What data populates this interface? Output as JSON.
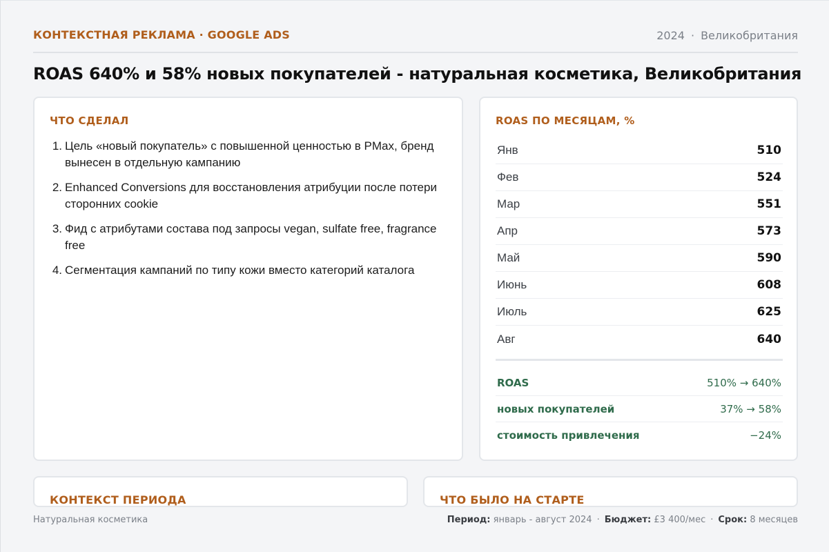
{
  "header": {
    "kicker": "КОНТЕКСТНАЯ РЕКЛАМА · GOOGLE ADS",
    "year": "2024",
    "separator": "·",
    "region": "Великобритания"
  },
  "headline": "ROAS 640% и 58% новых покупателей - натуральная косметика, Великобритания",
  "did": {
    "title": "ЧТО СДЕЛАЛ",
    "items": [
      {
        "num": "1.",
        "text": "Цель «новый покупатель» с повышенной ценностью в PMax, бренд вынесен в отдельную кампанию"
      },
      {
        "num": "2.",
        "text": "Enhanced Conversions для восстановления атрибуции после потери сторонних cookie"
      },
      {
        "num": "3.",
        "text": "Фид с атрибутами состава под запросы vegan, sulfate free, fragrance free"
      },
      {
        "num": "4.",
        "text": "Сегментация кампаний по типу кожи вместо категорий каталога"
      }
    ]
  },
  "roas": {
    "title": "ROAS ПО МЕСЯЦАМ, %",
    "months": [
      {
        "name": "Янв",
        "value": "510"
      },
      {
        "name": "Фев",
        "value": "524"
      },
      {
        "name": "Мар",
        "value": "551"
      },
      {
        "name": "Апр",
        "value": "573"
      },
      {
        "name": "Май",
        "value": "590"
      },
      {
        "name": "Июнь",
        "value": "608"
      },
      {
        "name": "Июль",
        "value": "625"
      },
      {
        "name": "Авг",
        "value": "640"
      }
    ],
    "summary": [
      {
        "label": "ROAS",
        "value": "510% → 640%"
      },
      {
        "label": "новых покупателей",
        "value": "37% → 58%"
      },
      {
        "label": "стоимость привлечения",
        "value": "−24%"
      }
    ]
  },
  "cards": {
    "context_title": "КОНТЕКСТ ПЕРИОДА",
    "start_title": "ЧТО БЫЛО НА СТАРТЕ"
  },
  "footer": {
    "niche": "Натуральная косметика",
    "period_label": "Период:",
    "period_value": "январь - август 2024",
    "budget_label": "Бюджет:",
    "budget_value": "£3 400/мес",
    "term_label": "Срок:",
    "term_value": "8 месяцев",
    "dot": "·"
  }
}
